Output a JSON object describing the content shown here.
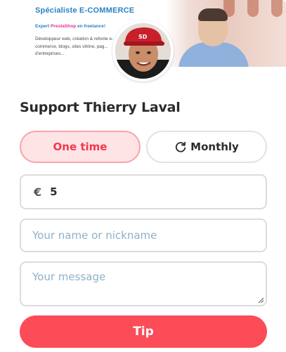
{
  "banner": {
    "title": "Spécialiste E-COMMERCE",
    "expert_prefix": "Expert ",
    "expert_brand": "PrestaShop",
    "expert_suffix": " en freelance!",
    "description": "Développeur web, création & refonte e-commerce, blogs, sites vitrine, pag... d'entreprises..."
  },
  "avatar": {
    "icon": "profile-photo-icon"
  },
  "page": {
    "title": "Support Thierry Laval"
  },
  "frequency": {
    "one_time_label": "One time",
    "monthly_label": "Monthly",
    "selected": "One time",
    "monthly_icon": "refresh-icon"
  },
  "amount": {
    "currency_symbol": "€",
    "value": "5"
  },
  "name_field": {
    "placeholder": "Your name or nickname",
    "value": ""
  },
  "message_field": {
    "placeholder": "Your message",
    "value": ""
  },
  "submit": {
    "label": "Tip"
  },
  "colors": {
    "accent": "#fb4c58",
    "selected_bg": "#ffe4e6",
    "selected_border": "#f9a4ab",
    "placeholder": "#8fb0c8"
  }
}
